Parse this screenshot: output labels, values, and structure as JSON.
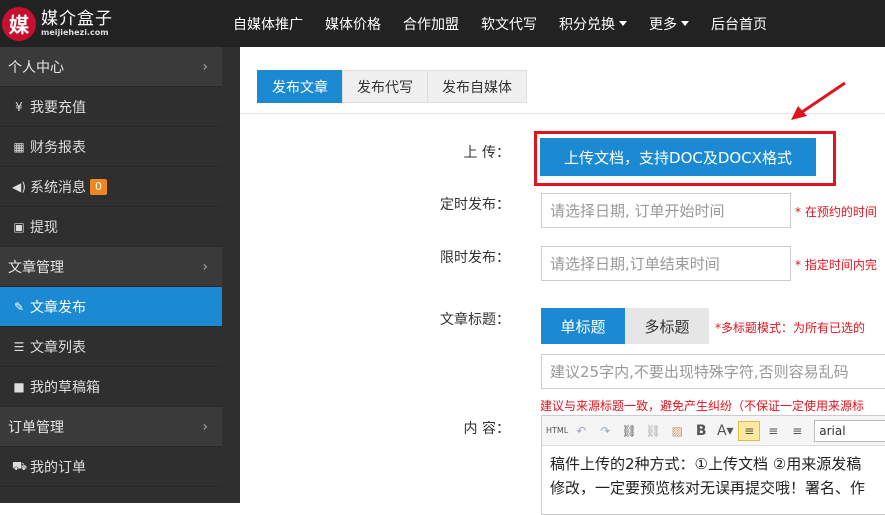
{
  "brand": {
    "mark": "媒",
    "name": "媒介盒子",
    "domain": "meijiehezi.com"
  },
  "nav": {
    "items": [
      {
        "label": "自媒体推广",
        "dropdown": false
      },
      {
        "label": "媒体价格",
        "dropdown": false
      },
      {
        "label": "合作加盟",
        "dropdown": false
      },
      {
        "label": "软文代写",
        "dropdown": false
      },
      {
        "label": "积分兑换",
        "dropdown": true
      },
      {
        "label": "更多",
        "dropdown": true
      },
      {
        "label": "后台首页",
        "dropdown": false
      }
    ]
  },
  "sidebar": {
    "items": [
      {
        "label": "个人中心",
        "type": "group",
        "icon": "chevron-right-icon"
      },
      {
        "label": "我要充值",
        "type": "sub",
        "icon": "yen-icon"
      },
      {
        "label": "财务报表",
        "type": "sub",
        "icon": "table-icon"
      },
      {
        "label": "系统消息",
        "type": "sub",
        "icon": "speaker-icon",
        "badge": "0"
      },
      {
        "label": "提现",
        "type": "sub",
        "icon": "cash-icon"
      },
      {
        "label": "文章管理",
        "type": "group",
        "icon": "chevron-right-icon"
      },
      {
        "label": "文章发布",
        "type": "sub",
        "icon": "edit-icon",
        "active": true
      },
      {
        "label": "文章列表",
        "type": "sub",
        "icon": "list-icon"
      },
      {
        "label": "我的草稿箱",
        "type": "sub",
        "icon": "video-icon"
      },
      {
        "label": "订单管理",
        "type": "group",
        "icon": "chevron-right-icon"
      },
      {
        "label": "我的订单",
        "type": "sub",
        "icon": "cart-icon"
      }
    ]
  },
  "tabs": [
    {
      "label": "发布文章",
      "active": true
    },
    {
      "label": "发布代写",
      "active": false
    },
    {
      "label": "发布自媒体",
      "active": false
    }
  ],
  "form": {
    "upload_label": "上 传：",
    "upload_button": "上传文档，支持DOC及DOCX格式",
    "schedule_label": "定时发布：",
    "schedule_placeholder": "请选择日期, 订单开始时间",
    "schedule_hint": "* 在预约的时间",
    "deadline_label": "限时发布：",
    "deadline_placeholder": "请选择日期,订单结束时间",
    "deadline_hint": "* 指定时间内完",
    "title_label": "文章标题：",
    "title_single": "单标题",
    "title_multi": "多标题",
    "title_hint": "*多标题模式：为所有已选的",
    "title_placeholder": "建议25字内,不要出现特殊字符,否则容易乱码",
    "title_warning": "建议与来源标题一致，避免产生纠纷（不保证一定使用来源标",
    "content_label": "内 容：",
    "font_value": "arial",
    "editor_line1": "稿件上传的2种方式：①上传文档 ②用来源发稿",
    "editor_line2": "修改，一定要预览核对无误再提交哦！署名、作"
  },
  "colors": {
    "primary": "#1b8ad3",
    "topbar": "#222222",
    "sidebar": "#2f2f2f",
    "alert": "#e0141e",
    "badge": "#f0861f"
  }
}
